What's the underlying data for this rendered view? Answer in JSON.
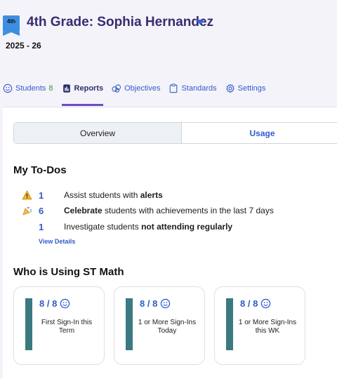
{
  "header": {
    "grade_badge": "4th",
    "title": "4th Grade: Sophia Hernandez",
    "school_year": "2025 - 26"
  },
  "tabs": [
    {
      "label": "Students",
      "count": "8",
      "icon": "smiley-icon"
    },
    {
      "label": "Reports",
      "icon": "report-icon",
      "active": true
    },
    {
      "label": "Objectives",
      "icon": "objectives-icon"
    },
    {
      "label": "Standards",
      "icon": "clipboard-icon"
    },
    {
      "label": "Settings",
      "icon": "gear-icon"
    }
  ],
  "segmented": {
    "overview": "Overview",
    "usage": "Usage"
  },
  "todos": {
    "heading": "My To-Dos",
    "items": [
      {
        "icon": "warning-icon",
        "count": "1",
        "pre": "Assist students with ",
        "bold": "alerts",
        "post": ""
      },
      {
        "icon": "party-popper-icon",
        "count": "6",
        "pre": "",
        "bold": "Celebrate",
        "post": " students with achievements in the last 7 days"
      },
      {
        "icon": "",
        "count": "1",
        "pre": "Investigate students ",
        "bold": "not attending regularly",
        "post": ""
      }
    ],
    "view_details": "View Details"
  },
  "usage": {
    "heading": "Who is Using ST Math",
    "cards": [
      {
        "stat": "8 / 8",
        "label": "First Sign-In this Term"
      },
      {
        "stat": "8 / 8",
        "label": "1 or More Sign-Ins Today"
      },
      {
        "stat": "8 / 8",
        "label": "1 or More Sign-Ins this WK"
      }
    ]
  },
  "colors": {
    "accent_blue": "#2f5cc9",
    "title_purple": "#3a2c6e",
    "count_green": "#3a8f45",
    "card_bar_teal": "#3a7a80"
  }
}
